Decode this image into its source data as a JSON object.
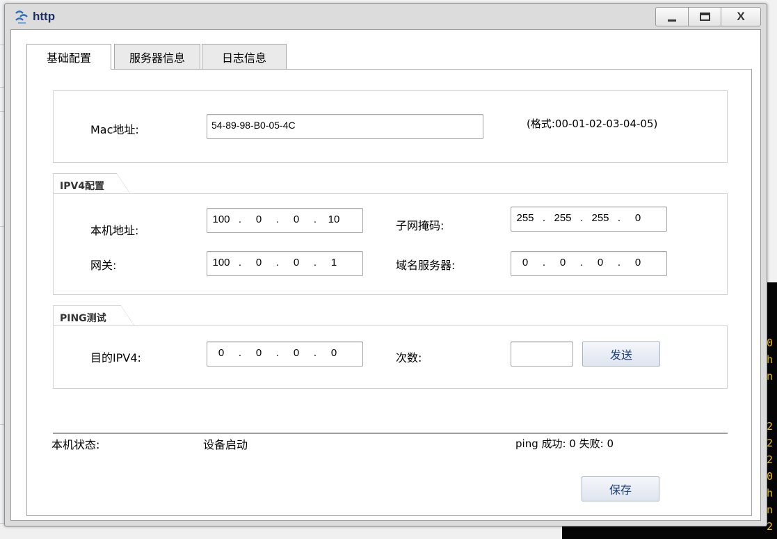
{
  "window": {
    "title": "http"
  },
  "tabs": [
    {
      "label": "基础配置",
      "active": true
    },
    {
      "label": "服务器信息",
      "active": false
    },
    {
      "label": "日志信息",
      "active": false
    }
  ],
  "mac": {
    "label": "Mac地址:",
    "value": "54-89-98-B0-05-4C",
    "hint": "(格式:00-01-02-03-04-05)"
  },
  "ipv4": {
    "section_title": "IPV4配置",
    "host_label": "本机地址:",
    "host_ip": [
      "100",
      "0",
      "0",
      "10"
    ],
    "mask_label": "子网掩码:",
    "mask_ip": [
      "255",
      "255",
      "255",
      "0"
    ],
    "gateway_label": "网关:",
    "gateway_ip": [
      "100",
      "0",
      "0",
      "1"
    ],
    "dns_label": "域名服务器:",
    "dns_ip": [
      "0",
      "0",
      "0",
      "0"
    ]
  },
  "ping": {
    "section_title": "PING测试",
    "dest_label": "目的IPV4:",
    "dest_ip": [
      "0",
      "0",
      "0",
      "0"
    ],
    "count_label": "次数:",
    "count_value": "",
    "send_label": "发送"
  },
  "status": {
    "label": "本机状态:",
    "value": "设备启动",
    "ping_result": "ping 成功: 0 失败: 0"
  },
  "save_label": "保存",
  "background_terminal_chars": [
    "0",
    "h",
    "n",
    "2",
    "2",
    "2",
    "0",
    "h",
    "n",
    "2",
    "2"
  ],
  "colors": {
    "title": "#1b2f5e",
    "button_text": "#1f3f7f",
    "terminal_bg": "#050505",
    "terminal_text": "#f2c200"
  }
}
